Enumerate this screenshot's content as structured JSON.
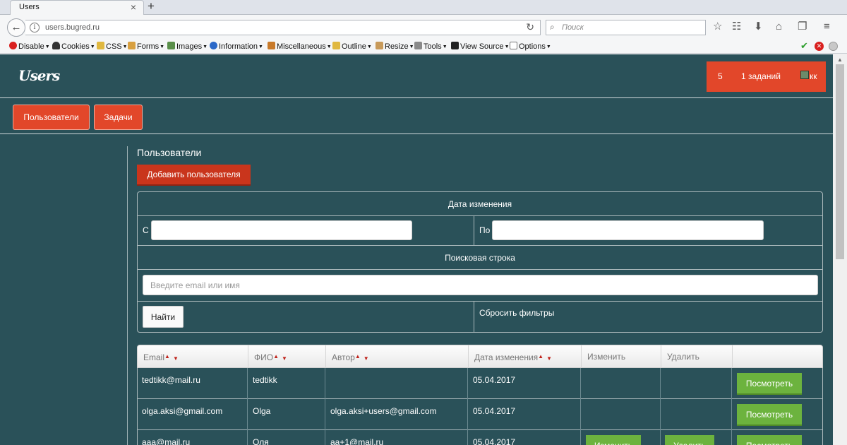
{
  "browser": {
    "tab_title": "Users",
    "tab_close": "×",
    "new_tab": "+",
    "url": "users.bugred.ru",
    "search_placeholder": "Поиск"
  },
  "devbar": {
    "items": [
      "Disable",
      "Cookies",
      "CSS",
      "Forms",
      "Images",
      "Information",
      "Miscellaneous",
      "Outline",
      "Resize",
      "Tools",
      "View Source",
      "Options"
    ]
  },
  "header": {
    "logo": "Users",
    "count": "5",
    "tasks": "1 заданий",
    "user_name": "кк"
  },
  "nav": {
    "users": "Пользователи",
    "tasks": "Задачи"
  },
  "section": {
    "title": "Пользователи",
    "add_button": "Добавить пользователя"
  },
  "filter": {
    "date_header": "Дата изменения",
    "from_label": "С",
    "to_label": "По",
    "from_value": "",
    "to_value": "",
    "search_header": "Поисковая строка",
    "search_value": "",
    "search_placeholder": "Введите email или имя",
    "find_button": "Найти",
    "reset": "Сбросить фильтры"
  },
  "table": {
    "columns": [
      "Email",
      "ФИО",
      "Автор",
      "Дата изменения",
      "Изменить",
      "Удалить",
      ""
    ],
    "rows": [
      {
        "email": "tedtikk@mail.ru",
        "fio": "tedtikk",
        "author": "",
        "date": "05.04.2017",
        "edit": "",
        "delete": "",
        "view": "Посмотреть"
      },
      {
        "email": "olga.aksi@gmail.com",
        "fio": "Olga",
        "author": "olga.aksi+users@gmail.com",
        "date": "05.04.2017",
        "edit": "",
        "delete": "",
        "view": "Посмотреть"
      },
      {
        "email": "aaa@mail.ru",
        "fio": "Оля",
        "author": "aa+1@mail.ru",
        "date": "05.04.2017",
        "edit": "Изменить",
        "delete": "Удалить",
        "view": "Посмотреть"
      }
    ]
  },
  "colors": {
    "page_bg": "#2a5159",
    "accent": "#e2472a",
    "button_green": "#6cb33e"
  }
}
